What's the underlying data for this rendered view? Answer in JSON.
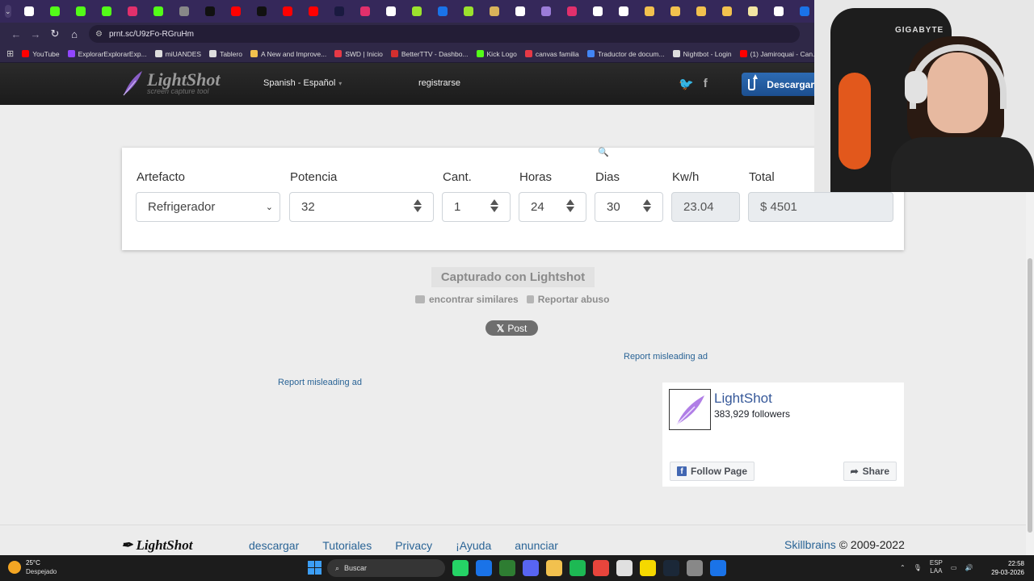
{
  "browser": {
    "url": "prnt.sc/U9zFo-RGruHm",
    "tab_colors": [
      "#ffffff",
      "#53fc18",
      "#53fc18",
      "#53fc18",
      "#e1306c",
      "#53fc18",
      "#888888",
      "#111111",
      "#ff0000",
      "#111111",
      "#ff0000",
      "#ff0000",
      "#1a1a40",
      "#e1306c",
      "#ffffff",
      "#9be22d",
      "#1a73e8",
      "#9be22d",
      "#d9b35a",
      "#ffffff",
      "#9b7cd8",
      "#e1306c",
      "#ffffff",
      "#ffffff",
      "#f2c14e",
      "#f2c14e",
      "#f2c14e",
      "#f2c14e",
      "#f2e5a2",
      "#ffffff",
      "#1a73e8"
    ],
    "bookmarks": [
      {
        "label": "YouTube",
        "color": "#ff0000"
      },
      {
        "label": "ExplorarExplorarExp...",
        "color": "#9146ff"
      },
      {
        "label": "miUANDES",
        "color": "#dddddd"
      },
      {
        "label": "Tablero",
        "color": "#dddddd"
      },
      {
        "label": "A New and Improve...",
        "color": "#f2c14e"
      },
      {
        "label": "SWD | Inicio",
        "color": "#e63946"
      },
      {
        "label": "BetterTTV - Dashbo...",
        "color": "#d32f2f"
      },
      {
        "label": "Kick Logo",
        "color": "#53fc18"
      },
      {
        "label": "canvas familia",
        "color": "#e63946"
      },
      {
        "label": "Traductor de docum...",
        "color": "#4285f4"
      },
      {
        "label": "Nightbot - Login",
        "color": "#dddddd"
      },
      {
        "label": "(1) Jamiroquai - Can...",
        "color": "#ff0000"
      }
    ]
  },
  "header": {
    "logo": "LightShot",
    "tagline": "screen capture tool",
    "language": "Spanish - Español",
    "register": "registrarse",
    "download": "Descargar"
  },
  "calculator": {
    "columns": [
      {
        "label": "Artefacto",
        "value": "Refrigerador",
        "kind": "select"
      },
      {
        "label": "Potencia",
        "value": "32",
        "kind": "number"
      },
      {
        "label": "Cant.",
        "value": "1",
        "kind": "number"
      },
      {
        "label": "Horas",
        "value": "24",
        "kind": "number"
      },
      {
        "label": "Dias",
        "value": "30",
        "kind": "number"
      },
      {
        "label": "Kw/h",
        "value": "23.04",
        "kind": "readonly"
      },
      {
        "label": "Total",
        "value": "$ 4501",
        "kind": "readonly"
      }
    ]
  },
  "center": {
    "captured": "Capturado con Lightshot",
    "find_similar": "encontrar similares",
    "report_abuse": "Reportar abuso",
    "post": "Post",
    "report_ad_right": "Report misleading ad",
    "report_ad_left": "Report misleading ad"
  },
  "facebook": {
    "name": "LightShot",
    "followers": "383,929 followers",
    "follow": "Follow Page",
    "share": "Share"
  },
  "footer": {
    "logo": "LightShot",
    "links": [
      "descargar",
      "Tutoriales",
      "Privacy",
      "¡Ayuda",
      "anunciar"
    ],
    "company": "Skillbrains",
    "copyright": "© 2009-2022"
  },
  "webcam": {
    "brand": "GIGABYTE"
  },
  "taskbar": {
    "temp": "25°C",
    "condition": "Despejado",
    "search": "Buscar",
    "lang_top": "ESP",
    "lang_bottom": "LAA",
    "time": "22:58",
    "date": "29-03-2026",
    "app_colors": [
      "#25d366",
      "#1a73e8",
      "#2e7d32",
      "#5865f2",
      "#f2c14e",
      "#1db954",
      "#e8453c",
      "#e0e0e0",
      "#f5d800",
      "#1b2838",
      "#888888",
      "#1a73e8"
    ]
  }
}
